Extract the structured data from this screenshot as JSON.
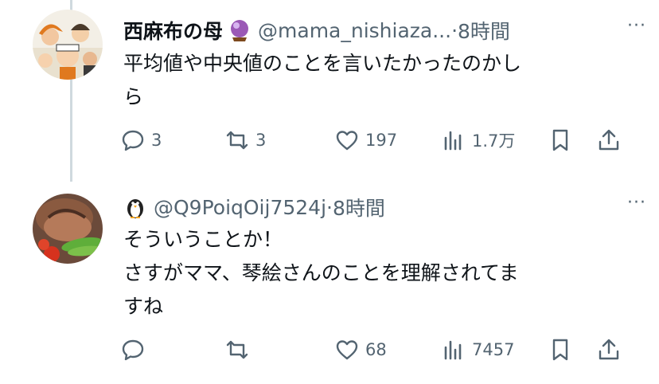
{
  "tweets": [
    {
      "name": "西麻布の母",
      "handle": "@mama_nishiaza...",
      "separator": "·",
      "time": "8時間",
      "more": "···",
      "text_lines": [
        "平均値や中央値のことを言いたかったのかし",
        "ら"
      ],
      "replies": "3",
      "retweets": "3",
      "likes": "197",
      "views": "1.7万",
      "badge_icon": "crystal-ball-icon",
      "avatar_icon": "illustration-avatar"
    },
    {
      "name": "",
      "handle": "@Q9PoiqOij7524j",
      "separator": "·",
      "time": "8時間",
      "more": "···",
      "text_lines": [
        "そういうことか！",
        "さすがママ、琴絵さんのことを理解されてま",
        "すね"
      ],
      "replies": "",
      "retweets": "",
      "likes": "68",
      "views": "7457",
      "badge_icon": "penguin-icon",
      "avatar_icon": "food-photo-avatar"
    }
  ],
  "colors": {
    "text": "#0f1419",
    "secondary": "#536471",
    "thread_line": "#cfd9de",
    "background": "#ffffff"
  }
}
